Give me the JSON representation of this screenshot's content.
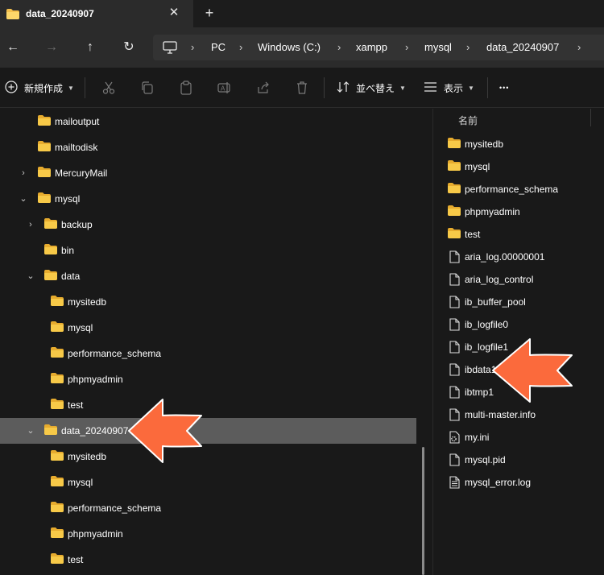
{
  "window": {
    "tab_title": "data_20240907",
    "tab_close": "✕",
    "new_tab": "+"
  },
  "navigation": {
    "back_icon": "←",
    "forward_icon": "→",
    "up_icon": "↑",
    "refresh_icon": "↻",
    "breadcrumbs": [
      "PC",
      "Windows (C:)",
      "xampp",
      "mysql",
      "data_20240907"
    ],
    "separator": "›"
  },
  "toolbar": {
    "new_label": "新規作成",
    "sort_label": "並べ替え",
    "view_label": "表示",
    "more_label": "•••",
    "icons": [
      "cut-icon",
      "copy-icon",
      "paste-icon",
      "rename-icon",
      "share-icon",
      "delete-icon"
    ]
  },
  "nav_tree": [
    {
      "label": "mailoutput",
      "chevron": ""
    },
    {
      "label": "mailtodisk",
      "chevron": ""
    },
    {
      "label": "MercuryMail",
      "chevron": "›"
    },
    {
      "label": "mysql",
      "chevron": "⌄"
    },
    {
      "label": "backup",
      "chevron": "›"
    },
    {
      "label": "bin",
      "chevron": ""
    },
    {
      "label": "data",
      "chevron": "⌄"
    },
    {
      "label": "mysitedb",
      "chevron": ""
    },
    {
      "label": "mysql",
      "chevron": ""
    },
    {
      "label": "performance_schema",
      "chevron": ""
    },
    {
      "label": "phpmyadmin",
      "chevron": ""
    },
    {
      "label": "test",
      "chevron": ""
    },
    {
      "label": "data_20240907",
      "chevron": "⌄",
      "selected": true
    },
    {
      "label": "mysitedb",
      "chevron": ""
    },
    {
      "label": "mysql",
      "chevron": ""
    },
    {
      "label": "performance_schema",
      "chevron": ""
    },
    {
      "label": "phpmyadmin",
      "chevron": ""
    },
    {
      "label": "test",
      "chevron": ""
    }
  ],
  "file_list": {
    "column_name": "名前",
    "items": [
      {
        "label": "mysitedb",
        "type": "folder"
      },
      {
        "label": "mysql",
        "type": "folder"
      },
      {
        "label": "performance_schema",
        "type": "folder"
      },
      {
        "label": "phpmyadmin",
        "type": "folder"
      },
      {
        "label": "test",
        "type": "folder"
      },
      {
        "label": "aria_log.00000001",
        "type": "file"
      },
      {
        "label": "aria_log_control",
        "type": "file"
      },
      {
        "label": "ib_buffer_pool",
        "type": "file"
      },
      {
        "label": "ib_logfile0",
        "type": "file"
      },
      {
        "label": "ib_logfile1",
        "type": "file"
      },
      {
        "label": "ibdata1",
        "type": "file"
      },
      {
        "label": "ibtmp1",
        "type": "file"
      },
      {
        "label": "multi-master.info",
        "type": "file"
      },
      {
        "label": "my.ini",
        "type": "settings"
      },
      {
        "label": "mysql.pid",
        "type": "file"
      },
      {
        "label": "mysql_error.log",
        "type": "text"
      }
    ]
  },
  "colors": {
    "folder": "#f4c04d",
    "annotation_arrow": "#fb6a3c",
    "selected_row": "#5c5c5c"
  }
}
